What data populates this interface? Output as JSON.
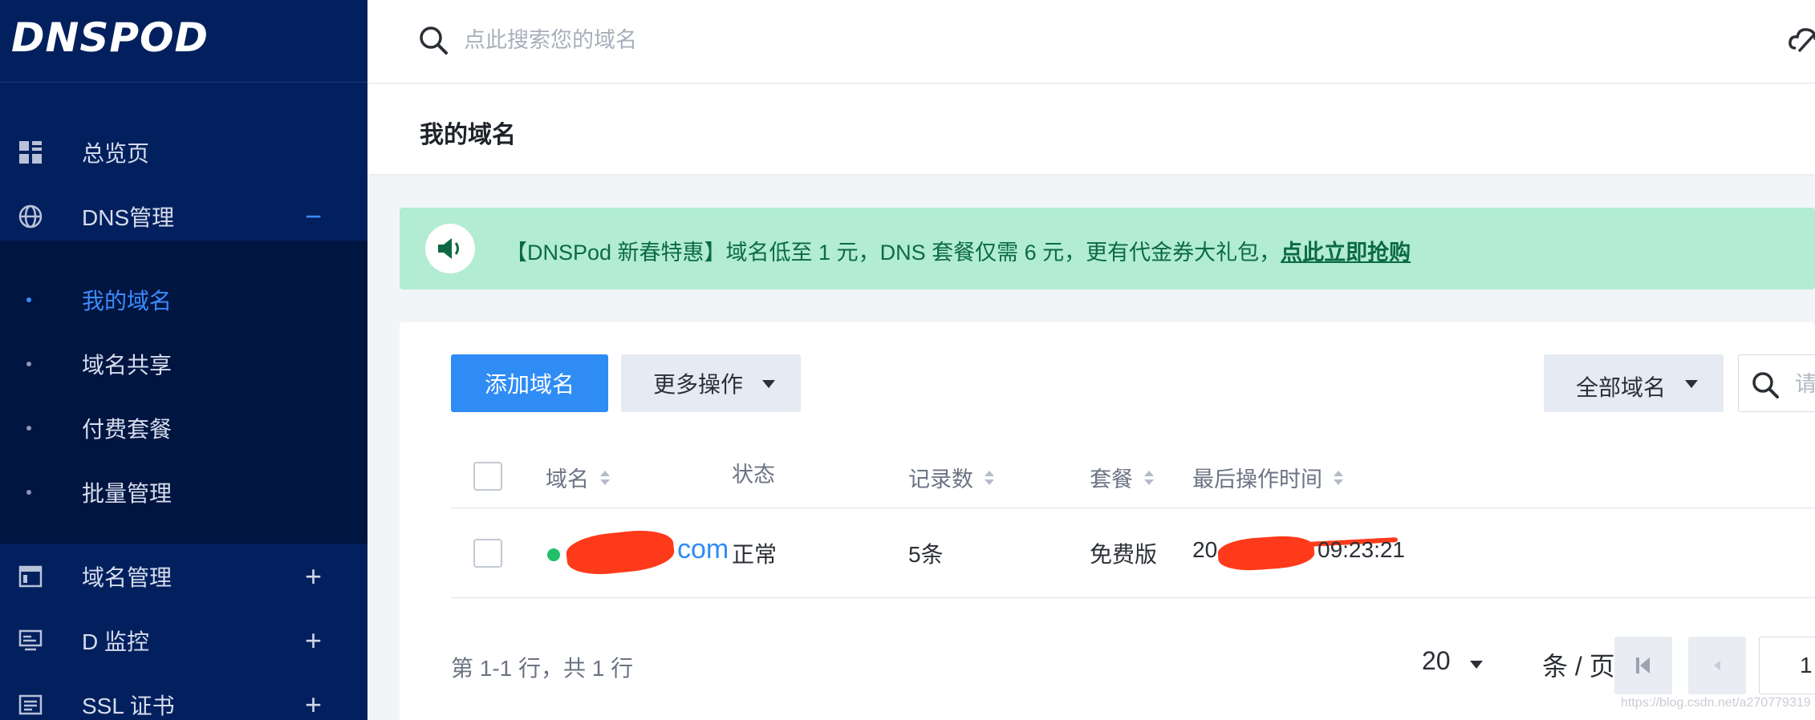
{
  "sidebar": {
    "logo": "DNSPOD",
    "items": [
      {
        "label": "总览页",
        "icon": "dashboard-grid-icon"
      },
      {
        "label": "DNS管理",
        "icon": "globe-icon",
        "toggle": "−"
      },
      {
        "label": "域名管理",
        "icon": "window-icon",
        "toggle": "+"
      },
      {
        "label": "D 监控",
        "icon": "monitor-icon",
        "toggle": "+"
      },
      {
        "label": "SSL 证书",
        "icon": "certificate-icon",
        "toggle": "+"
      }
    ],
    "submenu": [
      {
        "label": "我的域名",
        "active": true
      },
      {
        "label": "域名共享"
      },
      {
        "label": "付费套餐"
      },
      {
        "label": "批量管理"
      }
    ]
  },
  "topbar": {
    "search_placeholder": "点此搜索您的域名",
    "search_icon": "search-icon",
    "right_icon": "cloud-icon"
  },
  "page": {
    "title": "我的域名"
  },
  "banner": {
    "icon": "speaker-icon",
    "text": "【DNSPod 新春特惠】域名低至 1 元，DNS 套餐仅需 6 元，更有代金券大礼包，",
    "link": "点此立即抢购"
  },
  "toolbar": {
    "add_label": "添加域名",
    "more_label": "更多操作",
    "filter_label": "全部域名",
    "search_placeholder": "请"
  },
  "table": {
    "columns": [
      "域名",
      "状态",
      "记录数",
      "套餐",
      "最后操作时间"
    ],
    "rows": [
      {
        "domain": "com",
        "status": "正常",
        "records": "5条",
        "plan": "免费版",
        "time_prefix": "20",
        "time_suffix": "09:23:21"
      }
    ]
  },
  "pagination": {
    "summary": "第 1-1 行，共 1 行",
    "page_size": "20",
    "per_page_label": "条 / 页",
    "current_page": "1"
  },
  "watermark": "https://blog.csdn.net/a270779319",
  "colors": {
    "sidebar_bg": "#03205e",
    "submenu_bg": "#011541",
    "accent": "#2f8cf5",
    "banner_bg": "#b2ecd2",
    "banner_text": "#0b6a43",
    "status_ok": "#20c06a"
  }
}
